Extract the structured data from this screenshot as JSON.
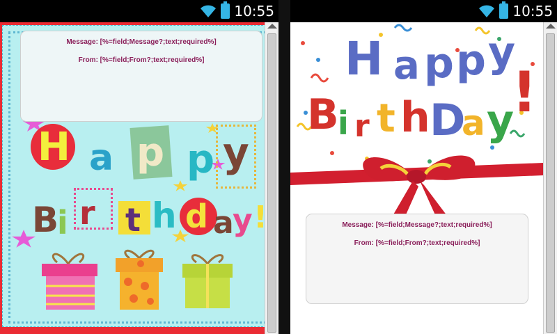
{
  "status_bar": {
    "time": "10:55"
  },
  "card_left": {
    "form": {
      "message": "Message: [%=field;Message?;text;required%]",
      "from": "From: [%=field;From?;text;required%]"
    },
    "happy": [
      "H",
      "a",
      "p",
      "p",
      "y"
    ],
    "birthday": [
      "B",
      "i",
      "r",
      "t",
      "h",
      "d",
      "a",
      "y",
      "!"
    ]
  },
  "card_right": {
    "happy": [
      "H",
      "a",
      "p",
      "p",
      "y"
    ],
    "birthday": [
      "B",
      "i",
      "r",
      "t",
      "h",
      "D",
      "a",
      "y",
      "!"
    ],
    "form": {
      "message": "Message: [%=field;Message?;text;required%]",
      "from": "From: [%=field;From?;text;required%]"
    }
  },
  "colors": {
    "accent": "#35b5e5",
    "card_left_border": "#ea2b33",
    "card_left_bg": "#b8eff0",
    "form_text": "#8a1f5a",
    "ribbon": "#d21f2f"
  }
}
